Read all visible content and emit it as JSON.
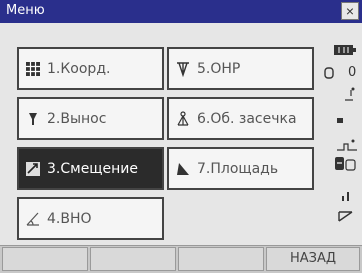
{
  "window": {
    "title": "Меню",
    "close_glyph": "×"
  },
  "menu": [
    {
      "label": "1.Коорд.",
      "icon": "grid-icon",
      "selected": false
    },
    {
      "label": "5.ОНР",
      "icon": "tripod-icon",
      "selected": false
    },
    {
      "label": "2.Вынос",
      "icon": "prism-icon",
      "selected": false
    },
    {
      "label": "6.Об. засечка",
      "icon": "resection-icon",
      "selected": false
    },
    {
      "label": "3.Смещение",
      "icon": "offset-icon",
      "selected": true
    },
    {
      "label": "7.Площадь",
      "icon": "area-icon",
      "selected": false
    },
    {
      "label": "4.ВНО",
      "icon": "angle-icon",
      "selected": false
    }
  ],
  "status": {
    "battery_icon": "battery-icon",
    "target_value": "0",
    "target_icon": "target-icon",
    "tilt_icon": "tilt-icon",
    "dot_icon": "dot-icon",
    "compensator_icon": "compensator-icon",
    "memory_icon": "memory-icon",
    "signal_icon": "signal-icon",
    "input_mode_icon": "input-mode-icon"
  },
  "softkeys": [
    "",
    "",
    "",
    "НАЗАД"
  ]
}
